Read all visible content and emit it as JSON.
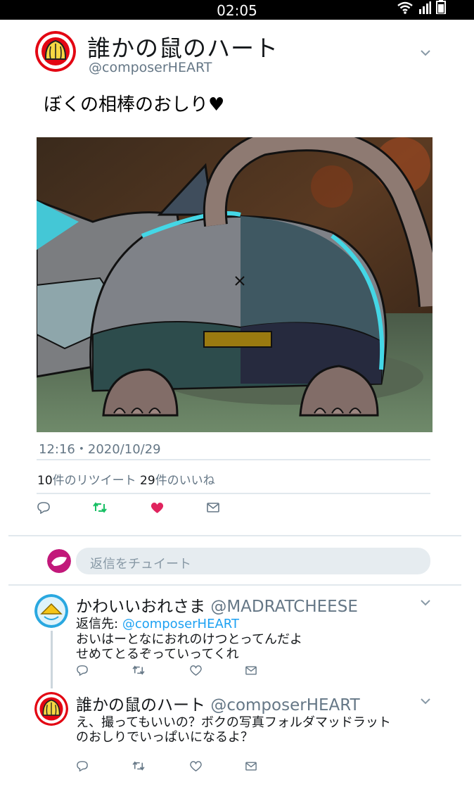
{
  "status_bar": {
    "time": "02:05",
    "icons": [
      "wifi-icon",
      "signal-icon",
      "battery-icon"
    ]
  },
  "tweet": {
    "author_name": "誰かの鼠のハート",
    "author_handle": "@composerHEART",
    "text": "ぼくの相棒のおしり♥",
    "timestamp": "12:16・2020/10/29",
    "retweet_count": "10",
    "retweet_label": "件のリツイート",
    "like_count": "29",
    "like_label": "件のいいね",
    "image_icon": "cartoon-rat-image"
  },
  "action_bar": {
    "icons": [
      "reply-icon",
      "retweet-icon",
      "like-icon",
      "share-icon"
    ],
    "colors": {
      "retweet": "#17bf63",
      "like": "#e0245e",
      "default": "#657786"
    }
  },
  "reply_composer": {
    "placeholder": "返信をチュイート"
  },
  "replies": [
    {
      "author_name": "かわいいおれさま",
      "author_handle": "@MADRATCHEESE",
      "reply_to_label": "返信先:",
      "reply_to_handle": "@composerHEART",
      "text": "おいはーとなにおれのけつとってんだよ\nせめてとるぞっていってくれ"
    },
    {
      "author_name": "誰かの鼠のハート",
      "author_handle": "@composerHEART",
      "text": "え、撮ってもいいの？ボクの写真フォルダマッドラット\nのおしりでいっぱいになるよ？"
    }
  ],
  "colors": {
    "link": "#1da1f2",
    "muted": "#657786",
    "divider": "#e1e8ed"
  }
}
